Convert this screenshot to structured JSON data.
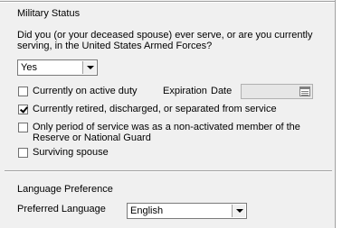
{
  "military": {
    "section_title": "Military Status",
    "question_line1": "Did you (or your deceased spouse) ever serve, or are you currently",
    "question_line2": "serving, in the United States Armed Forces?",
    "served_value": "Yes",
    "active_duty_label": "Currently on active duty",
    "active_duty_checked": false,
    "expiration_label": "Expiration",
    "date_label": "Date",
    "expiration_date_value": "",
    "retired_label": "Currently retired, discharged, or separated from service",
    "retired_checked": true,
    "reserve_label_line1": "Only period of service was as a non-activated member of the",
    "reserve_label_line2": "Reserve or National Guard",
    "reserve_checked": false,
    "surviving_spouse_label": "Surviving spouse",
    "surviving_spouse_checked": false
  },
  "language": {
    "section_title": "Language Preference",
    "preferred_label": "Preferred Language",
    "preferred_value": "English"
  },
  "icons": {
    "calendar": "calendar-icon",
    "dropdown": "chevron-down-icon",
    "check": "checkmark-icon"
  },
  "colors": {
    "panel_bg": "#f0f0f0",
    "divider": "#a0a0a0",
    "disabled_field": "#e6e6e6"
  }
}
